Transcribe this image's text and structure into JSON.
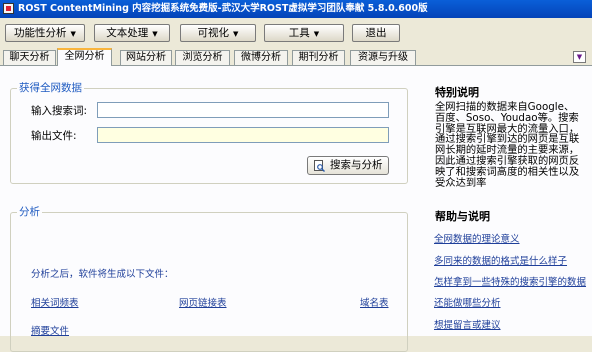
{
  "window": {
    "title": "ROST ContentMining 内容挖掘系统免费版-武汉大学ROST虚拟学习团队奉献  5.8.0.600版"
  },
  "toolbar": {
    "functional_analysis": "功能性分析",
    "text_processing": "文本处理",
    "visualization": "可视化",
    "tools": "工具",
    "exit": "退出",
    "dropdown_arrow": "▼"
  },
  "tabs": [
    "聊天分析",
    "全网分析",
    "网站分析",
    "浏览分析",
    "微博分析",
    "期刊分析",
    "资源与升级"
  ],
  "tab_scroll_glyph": "▼",
  "search_group": {
    "legend": "获得全网数据",
    "keyword_label": "输入搜索词:",
    "keyword_value": "",
    "output_label": "输出文件:",
    "output_value": "",
    "search_button": "搜索与分析"
  },
  "analysis_group": {
    "legend": "分析",
    "hint": "分析之后，软件将生成以下文件：",
    "files": [
      "相关词频表",
      "网页链接表",
      "域名表",
      "摘要文件"
    ]
  },
  "sidebar": {
    "notes_title": "特别说明",
    "notes_text": "全网扫描的数据来自Google、百度、Soso、Youdao等。搜索引擎是互联网最大的流量入口，通过搜索引擎到达的网页是互联网长期的延时流量的主要来源，因此通过搜索引擎获取的网页反映了和搜索词高度的相关性以及受众达到率",
    "help_title": "帮助与说明",
    "help_links": [
      "全网数据的理论意义",
      "多同来的数据的格式是什么样子",
      "怎样拿到一些特殊的搜索引擎的数据",
      "还能做哪些分析",
      "想提留言或建议"
    ]
  }
}
